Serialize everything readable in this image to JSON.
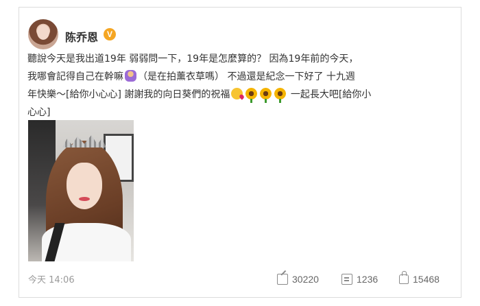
{
  "post": {
    "author": "陈乔恩",
    "verified_badge": "V",
    "text_lines": [
      "聽說今天是我出道19年 弱弱問一下，19年是怎麼算的？ 因為19年前的今天，",
      "我哪會記得自己在幹嘛",
      "（是在拍薰衣草嗎） 不過還是紀念一下好了 十九週",
      "年快樂～[給你小心心] 謝謝我的向日葵們的祝福",
      "一起長大吧[給你小",
      "心心]"
    ],
    "photo_alt_icon": "post-photo",
    "time": "今天 14:06",
    "forward_count": "30220",
    "comment_count": "1236",
    "like_count": "15468"
  },
  "icons": {
    "shrug": "woman-shrugging-emoji",
    "kiss": "face-blowing-kiss-emoji",
    "sunflower": "sunflower-emoji",
    "forward": "share-icon",
    "comment": "comment-icon",
    "like": "thumbs-up-icon"
  },
  "colors": {
    "text": "#333333",
    "meta": "#999999",
    "badge": "#f5a623",
    "border": "#dcdcdc"
  }
}
